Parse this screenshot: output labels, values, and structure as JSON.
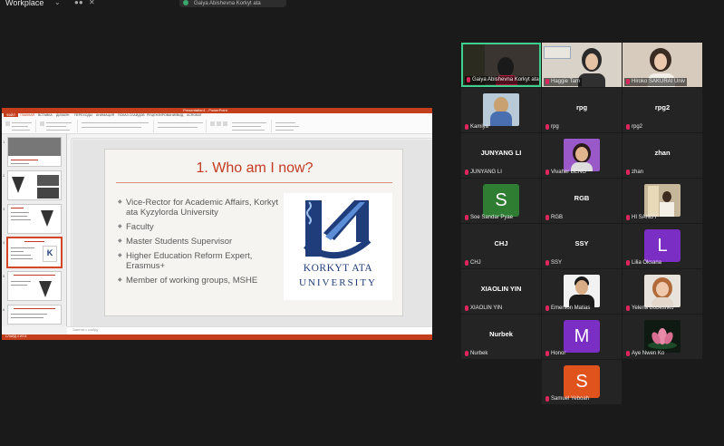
{
  "app": {
    "title": "Workplace"
  },
  "topbar": {
    "share_label": "Gaiya Abishevna Korkyt ata"
  },
  "powerpoint": {
    "window_title": "Presentation1 - PowerPoint",
    "tabs": [
      "ФАЙЛ",
      "ГЛАВНАЯ",
      "ВСТАВКА",
      "ДИЗАЙН",
      "ПЕРЕХОДЫ",
      "АНИМАЦИЯ",
      "ПОКАЗ СЛАЙДОВ",
      "РЕЦЕНЗИРОВАНИЕ",
      "ВИД",
      "ACROBAT"
    ],
    "notes_placeholder": "Заметки к слайду",
    "status": "СЛАЙД 4 ИЗ 8",
    "thumbs": [
      {
        "num": "1"
      },
      {
        "num": "2"
      },
      {
        "num": "3"
      },
      {
        "num": "4"
      },
      {
        "num": "5"
      },
      {
        "num": "6"
      }
    ]
  },
  "slide": {
    "title": "1. Who am I now?",
    "bullets": [
      "Vice-Rector for Academic Affairs, Korkyt ata Kyzylorda University",
      "Faculty",
      "Master Students Supervisor",
      "Higher Education Reform Expert, Erasmus+",
      "Member of working groups, MSHE"
    ],
    "logo_line1": "KORKYT ATA",
    "logo_line2": "UNIVERSITY"
  },
  "participants": [
    {
      "name": "Gaiya Abishevna Korkyt ata",
      "type": "video",
      "active": true
    },
    {
      "name": "Haggie Tam",
      "type": "video"
    },
    {
      "name": "Hiroko SAKURAI Univ",
      "type": "video"
    },
    {
      "name": "Kamiya",
      "type": "photo"
    },
    {
      "name": "rpg",
      "big": "rpg",
      "type": "name"
    },
    {
      "name": "rpg2",
      "big": "rpg2",
      "type": "name"
    },
    {
      "name": "JUNYANG LI",
      "big": "JUNYANG LI",
      "type": "name"
    },
    {
      "name": "Vivaher BENG",
      "type": "photo"
    },
    {
      "name": "zhan",
      "big": "zhan",
      "type": "name"
    },
    {
      "name": "Soe Sandar Pyae",
      "letter": "S",
      "color": "#2e7d32",
      "type": "letter"
    },
    {
      "name": "RGB",
      "big": "RGB",
      "type": "name"
    },
    {
      "name": "HI SANDY",
      "type": "photo"
    },
    {
      "name": "CHJ",
      "big": "CHJ",
      "type": "name"
    },
    {
      "name": "SSY",
      "big": "SSY",
      "type": "name"
    },
    {
      "name": "Lilia Oksana",
      "letter": "L",
      "color": "#7b2ec4",
      "type": "letter"
    },
    {
      "name": "XIAOLIN YIN",
      "big": "XIAOLIN YIN",
      "type": "name"
    },
    {
      "name": "Emerson Matias",
      "type": "photo"
    },
    {
      "name": "Yelena Bobeshko",
      "type": "photo"
    },
    {
      "name": "Nurbek",
      "big": "Nurbek",
      "type": "name"
    },
    {
      "name": "Honor",
      "letter": "M",
      "color": "#7b2ec4",
      "type": "letter"
    },
    {
      "name": "Aye Nwen Ko",
      "type": "photo"
    },
    {
      "name": "Samuel Yeboah",
      "letter": "S",
      "color": "#e0531c",
      "type": "letter"
    }
  ]
}
